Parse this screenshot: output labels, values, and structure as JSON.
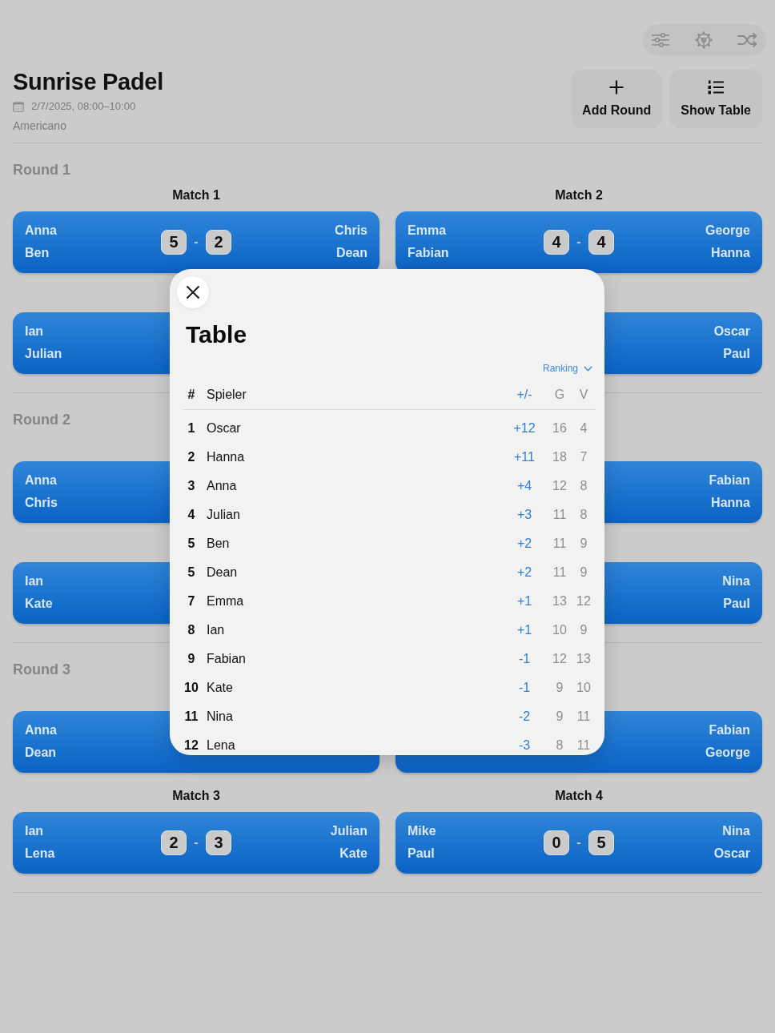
{
  "header": {
    "title": "Sunrise Padel",
    "date": "2/7/2025, 08:00–10:00",
    "format": "Americano"
  },
  "actions": [
    {
      "label": "Add Round",
      "kind": "add"
    },
    {
      "label": "Show Table",
      "kind": "table"
    }
  ],
  "rounds": [
    {
      "title": "Round 1",
      "matches": [
        {
          "title": "Match 1",
          "team_a": [
            "Anna",
            "Ben"
          ],
          "score_a": "5",
          "separator": "-",
          "score_b": "2",
          "team_b": [
            "Chris",
            "Dean"
          ]
        },
        {
          "title": "Match 2",
          "team_a": [
            "Emma",
            "Fabian"
          ],
          "score_a": "4",
          "separator": "-",
          "score_b": "4",
          "team_b": [
            "George",
            "Hanna"
          ]
        },
        {
          "team_a": [
            "Ian",
            "Julian"
          ]
        },
        {
          "team_b": [
            "Oscar",
            "Paul"
          ]
        }
      ]
    },
    {
      "title": "Round 2",
      "matches": [
        {
          "team_a": [
            "Anna",
            "Chris"
          ]
        },
        {
          "team_b": [
            "Fabian",
            "Hanna"
          ]
        },
        {
          "team_a": [
            "Ian",
            "Kate"
          ]
        },
        {
          "team_b": [
            "Nina",
            "Paul"
          ]
        }
      ]
    },
    {
      "title": "Round 3",
      "matches": [
        {
          "team_a": [
            "Anna",
            "Dean"
          ]
        },
        {
          "team_b": [
            "Fabian",
            "George"
          ]
        },
        {
          "title": "Match 3",
          "team_a": [
            "Ian",
            "Lena"
          ],
          "score_a": "2",
          "separator": "-",
          "score_b": "3",
          "team_b": [
            "Julian",
            "Kate"
          ]
        },
        {
          "title": "Match 4",
          "team_a": [
            "Mike",
            "Paul"
          ],
          "score_a": "0",
          "separator": "-",
          "score_b": "5",
          "team_b": [
            "Nina",
            "Oscar"
          ]
        }
      ]
    }
  ],
  "table_sheet": {
    "title": "Table",
    "sort_menu": {
      "label": "Ranking"
    },
    "columns": [
      {
        "label": "#",
        "kind": "rank"
      },
      {
        "label": "Spieler",
        "kind": "player"
      },
      {
        "label": "+/-",
        "kind": "diff"
      },
      {
        "label": "G",
        "kind": "count"
      },
      {
        "label": "V",
        "kind": "count"
      }
    ],
    "rows": [
      [
        "1",
        "Oscar",
        "+12",
        "16",
        "4"
      ],
      [
        "2",
        "Hanna",
        "+11",
        "18",
        "7"
      ],
      [
        "3",
        "Anna",
        "+4",
        "12",
        "8"
      ],
      [
        "4",
        "Julian",
        "+3",
        "11",
        "8"
      ],
      [
        "5",
        "Ben",
        "+2",
        "11",
        "9"
      ],
      [
        "5",
        "Dean",
        "+2",
        "11",
        "9"
      ],
      [
        "7",
        "Emma",
        "+1",
        "13",
        "12"
      ],
      [
        "8",
        "Ian",
        "+1",
        "10",
        "9"
      ],
      [
        "9",
        "Fabian",
        "-1",
        "12",
        "13"
      ],
      [
        "10",
        "Kate",
        "-1",
        "9",
        "10"
      ],
      [
        "11",
        "Nina",
        "-2",
        "9",
        "11"
      ],
      [
        "12",
        "Lena",
        "-3",
        "8",
        "11"
      ]
    ]
  }
}
